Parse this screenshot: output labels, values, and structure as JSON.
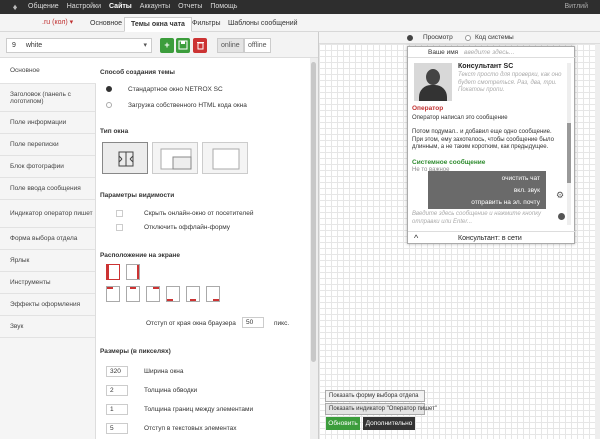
{
  "topbar": {
    "nav": [
      "Общение",
      "Настройки",
      "Сайты",
      "Аккаунты",
      "Отчеты",
      "Помощь"
    ],
    "active_index": 2,
    "user": "Витлий"
  },
  "tabs": {
    "site_selector": ".ru (кол) ▾",
    "items": [
      "Основное",
      "Темы окна чата",
      "Фильтры",
      "Шаблоны сообщений"
    ],
    "active_index": 1
  },
  "toolbar": {
    "widget_number": "9",
    "widget_name": "white",
    "online_label": "online",
    "offline_label": "offline"
  },
  "sidemenu": {
    "items": [
      "Основное",
      "Заголовок (панель с логотипом)",
      "Поле информации",
      "Поле переписки",
      "Блок фотографии",
      "Поле ввода сообщения",
      "Индикатор оператор пишет",
      "Форма выбора отдела",
      "Ярлык",
      "Инструменты",
      "Эффекты оформления",
      "Звук"
    ],
    "active_index": 0
  },
  "form": {
    "creation_title": "Способ создания темы",
    "creation_opt1": "Стандартное окно NETROX SC",
    "creation_opt2": "Загрузка собственного HTML кода окна",
    "window_type_title": "Тип окна",
    "visibility_title": "Параметры видимости",
    "visibility_opt1": "Скрыть онлайн-окно от посетителей",
    "visibility_opt2": "Отключить оффлайн-форму",
    "placement_title": "Расположение на экране",
    "offset_label": "Отступ от края окна браузера",
    "offset_value": "50",
    "offset_unit": "пикс.",
    "sizes_title": "Размеры (в пикселях)",
    "sizes": [
      {
        "value": "320",
        "label": "Ширина окна"
      },
      {
        "value": "2",
        "label": "Толщина обводки"
      },
      {
        "value": "1",
        "label": "Толщина границ между элементами"
      },
      {
        "value": "5",
        "label": "Отступ в текстовых элементах"
      }
    ]
  },
  "preview": {
    "mode_preview": "Просмотр",
    "mode_code": "Код системы",
    "name_label": "Ваше имя",
    "name_placeholder": "введите здесь...",
    "consultant_name": "Консультант SC",
    "consultant_desc": "Текст просто для проверки, как оно будет смотреться. Раз, два, три. Покатоы пропи.",
    "operator_label": "Оператор",
    "operator_msg1": "Оператор написал это сообщение",
    "operator_msg2": "Потом подумал.. и добавил еще одно сообщение. При этом, ему захотелось, чтобы сообщение было длинным, а не таким коротким, как предыдущее.",
    "system_label": "Системное сообщение",
    "system_sub": "Не то важное",
    "menu_items": [
      "очистить чат",
      "вкл. звук",
      "отправить на эл. почту"
    ],
    "input_placeholder": "Введите здесь сообщение и нажмите кнопку отправки или Enter...",
    "status": "Консультант: в сети"
  },
  "bottom": {
    "opt1": "Показать форму выбора отдела",
    "opt2": "Показать индикатор \"Оператор пишет\"",
    "update_label": "Обновить",
    "more_label": "Дополнительно"
  },
  "colors": {
    "accent_green": "#3c9d3c",
    "delete_red": "#cc3333",
    "operator_red": "#c03030",
    "system_green": "#2e8b2e"
  }
}
